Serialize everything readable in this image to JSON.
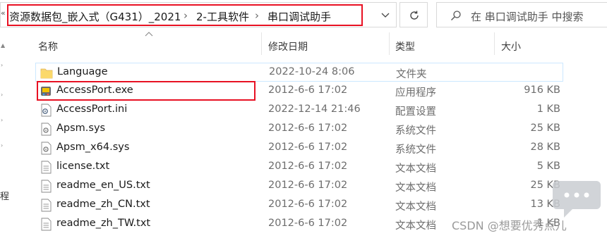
{
  "address_bar": {
    "path_segments": [
      "资源数据包_嵌入式（G431）_2021",
      "2-工具软件",
      "串口调试助手"
    ],
    "separator": "›"
  },
  "search": {
    "placeholder": "在 串口调试助手 中搜索"
  },
  "columns": {
    "name": "名称",
    "modified": "修改日期",
    "type": "类型",
    "size": "大小"
  },
  "files": [
    {
      "name": "Language",
      "modified": "2022-10-24 8:06",
      "type": "文件夹",
      "size": "",
      "icon": "folder-icon"
    },
    {
      "name": "AccessPort.exe",
      "modified": "2012-6-6 17:02",
      "type": "应用程序",
      "size": "916 KB",
      "icon": "exe-icon"
    },
    {
      "name": "AccessPort.ini",
      "modified": "2022-12-14 21:46",
      "type": "配置设置",
      "size": "1 KB",
      "icon": "settings-file-icon"
    },
    {
      "name": "Apsm.sys",
      "modified": "2012-6-6 17:02",
      "type": "系统文件",
      "size": "25 KB",
      "icon": "system-file-icon"
    },
    {
      "name": "Apsm_x64.sys",
      "modified": "2012-6-6 17:02",
      "type": "系统文件",
      "size": "28 KB",
      "icon": "system-file-icon"
    },
    {
      "name": "license.txt",
      "modified": "2012-6-6 17:02",
      "type": "文本文档",
      "size": "5 KB",
      "icon": "text-file-icon"
    },
    {
      "name": "readme_en_US.txt",
      "modified": "2012-6-6 17:02",
      "type": "文本文档",
      "size": "25 KB",
      "icon": "text-file-icon"
    },
    {
      "name": "readme_zh_CN.txt",
      "modified": "2012-6-6 17:02",
      "type": "文本文档",
      "size": "13 KB",
      "icon": "text-file-icon"
    },
    {
      "name": "readme_zh_TW.txt",
      "modified": "2012-6-6 17:02",
      "type": "文本文档",
      "size": "1 KB",
      "icon": "text-file-icon"
    }
  ],
  "nav_partial_text": "程",
  "watermark": {
    "text": "CSDN @想要优秀点儿",
    "bubble_icon": "chat-bubble-icon"
  },
  "colors": {
    "highlight_red": "#e81123",
    "hover_blue": "#cce8ff",
    "folder_yellow": "#f8d775"
  }
}
